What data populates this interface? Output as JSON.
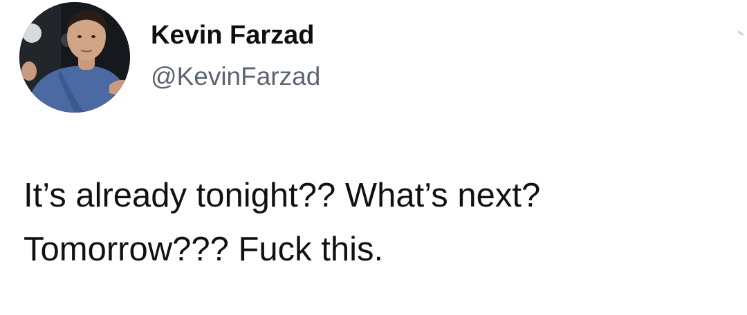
{
  "tweet": {
    "author": {
      "display_name": "Kevin Farzad",
      "handle": "@KevinFarzad",
      "avatar_icon": "profile-photo"
    },
    "body_lines": [
      "It’s already tonight?? What’s next?",
      "Tomorrow??? Fuck this."
    ],
    "menu_icon": "chevron-down-icon"
  }
}
